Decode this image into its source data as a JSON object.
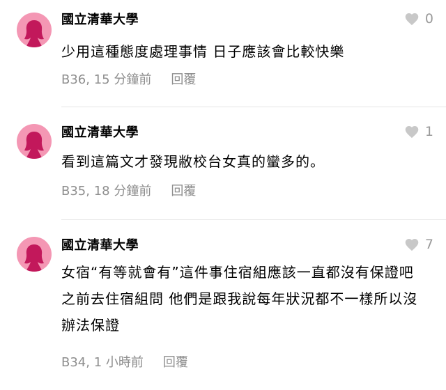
{
  "comments": [
    {
      "author": "國立清華大學",
      "likes": "0",
      "text": "少用這種態度處理事情 日子應該會比較快樂",
      "floor_time": "B36, 15 分鐘前",
      "reply_label": "回覆"
    },
    {
      "author": "國立清華大學",
      "likes": "1",
      "text": "看到這篇文才發現敝校台女真的蠻多的。",
      "floor_time": "B35, 18 分鐘前",
      "reply_label": "回覆"
    },
    {
      "author": "國立清華大學",
      "likes": "7",
      "text": "女宿“有等就會有”這件事住宿組應該一直都沒有保證吧 之前去住宿組問 他們是跟我說每年狀況都不一樣所以沒辦法保證",
      "floor_time": "B34, 1 小時前",
      "reply_label": "回覆"
    }
  ],
  "colors": {
    "avatar_bg": "#f497b4",
    "avatar_fg": "#c2185b",
    "meta_text": "#8e8e8e",
    "heart": "#c8c8c8"
  },
  "icons": {
    "avatar": "female-avatar-icon",
    "like": "heart-icon"
  }
}
